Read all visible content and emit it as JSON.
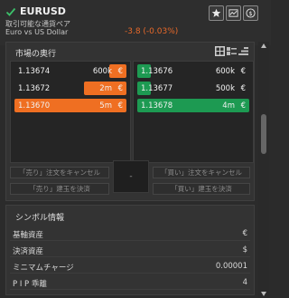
{
  "header": {
    "symbol": "EURUSD",
    "subtitle_tradable": "取引可能な通貨ペア",
    "subtitle_name": "Euro vs US Dollar",
    "change": "-3.8 (-0.03%)",
    "icons": [
      "star-icon",
      "chart-icon",
      "dollar-icon"
    ]
  },
  "depth": {
    "title": "市場の奥行",
    "view_icons": [
      "grid-view-icon",
      "list-view-icon",
      "compact-view-icon"
    ],
    "sell_rows": [
      {
        "price": "1.13674",
        "qty": "600k",
        "cur": "€",
        "fill": 0.15
      },
      {
        "price": "1.13672",
        "qty": "2m",
        "cur": "€",
        "fill": 0.38
      },
      {
        "price": "1.13670",
        "qty": "5m",
        "cur": "€",
        "fill": 1.0
      }
    ],
    "buy_rows": [
      {
        "price": "1.13676",
        "qty": "600k",
        "cur": "€",
        "fill": 0.12
      },
      {
        "price": "1.13677",
        "qty": "500k",
        "cur": "€",
        "fill": 0.12
      },
      {
        "price": "1.13678",
        "qty": "4m",
        "cur": "€",
        "fill": 1.0
      }
    ],
    "spread": "-",
    "buttons": {
      "cancel_sell": "「売り」注文をキャンセル",
      "close_sell": "「売り」建玉を決済",
      "cancel_buy": "「買い」注文をキャンセル",
      "close_buy": "「買い」建玉を決済"
    }
  },
  "symbol_info": {
    "title": "シンボル情報",
    "rows": [
      {
        "key": "基軸資産",
        "value": "€"
      },
      {
        "key": "決済資産",
        "value": "$"
      },
      {
        "key": "ミニマムチャージ",
        "value": "0.00001"
      },
      {
        "key": "P I P 乖離",
        "value": "4"
      }
    ]
  },
  "colors": {
    "sell": "#ef6f22",
    "buy": "#1d9a52",
    "change": "#e8692a",
    "check": "#3cc06a"
  }
}
